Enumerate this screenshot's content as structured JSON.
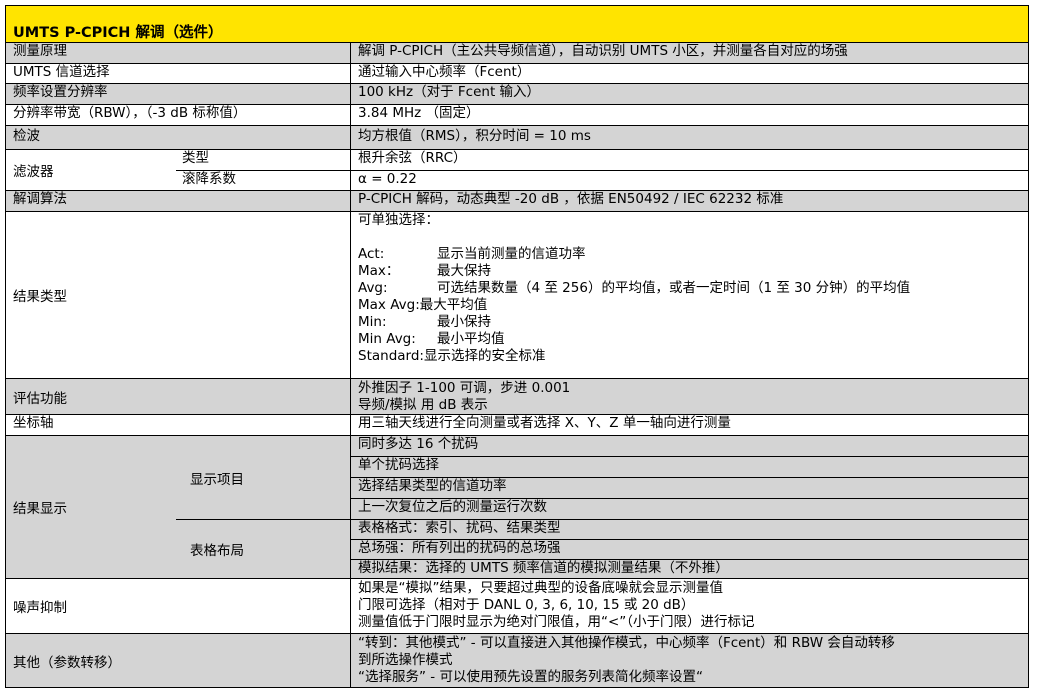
{
  "title": "UMTS P-CPICH 解调（选件）",
  "rows": [
    {
      "label": "测量原理",
      "value": "解调 P-CPICH（主公共导频信道），自动识别 UMTS 小区，并测量各自对应的场强"
    },
    {
      "label": "UMTS 信道选择",
      "value": "通过输入中心频率（Fcent）"
    },
    {
      "label": "频率设置分辨率",
      "value": "100 kHz（对于 Fcent 输入）"
    },
    {
      "label": "分辨率带宽（RBW），（-3 dB 标称值）",
      "value": "3.84 MHz （固定）"
    },
    {
      "label": "检波",
      "value": "均方根值（RMS），积分时间 = 10 ms"
    }
  ],
  "filter": {
    "label": "滤波器",
    "type_label": "类型",
    "type_value": "根升余弦（RRC）",
    "rolloff_label": "滚降系数",
    "rolloff_value": "α = 0.22"
  },
  "demod": {
    "label": "解调算法",
    "value": "P-CPICH 解码，动态典型 -20 dB ，依据 EN50492 / IEC 62232 标准"
  },
  "result_type": {
    "label": "结果类型",
    "intro": "可单独选择：",
    "items": [
      {
        "key": "Act:",
        "text": "显示当前测量的信道功率"
      },
      {
        "key": "Max：",
        "text": "最大保持"
      },
      {
        "key": "Avg:",
        "text": "可选结果数量（4 至 256）的平均值，或者一定时间（1 至 30 分钟）的平均值"
      },
      {
        "key": "Max Avg:",
        "text": "最大平均值"
      },
      {
        "key": "Min:",
        "text": "最小保持"
      },
      {
        "key": "Min Avg:",
        "text": "最小平均值"
      },
      {
        "key": "Standard:",
        "text": "显示选择的安全标准"
      }
    ]
  },
  "evaluation": {
    "label": "评估功能",
    "lines": [
      "外推因子 1-100 可调，步进 0.001",
      "导频/模拟 用 dB 表示"
    ]
  },
  "axis": {
    "label": "坐标轴",
    "value": "用三轴天线进行全向测量或者选择 X、Y、Z 单一轴向进行测量"
  },
  "result_display": {
    "label": "结果显示",
    "display_items_label": "显示项目",
    "display_items": [
      "同时多达 16 个扰码",
      "单个扰码选择",
      "选择结果类型的信道功率",
      "上一次复位之后的测量运行次数"
    ],
    "table_layout_label": "表格布局",
    "table_layout": [
      "表格格式：索引、扰码、结果类型",
      "总场强：所有列出的扰码的总场强",
      "模拟结果：选择的 UMTS 频率信道的模拟测量结果（不外推）"
    ]
  },
  "noise": {
    "label": "噪声抑制",
    "lines": [
      "如果是“模拟”结果，只要超过典型的设备底噪就会显示测量值",
      "门限可选择（相对于 DANL 0, 3, 6, 10, 15 或 20 dB）",
      "测量值低于门限时显示为绝对门限值，用“<”（小于门限）进行标记"
    ]
  },
  "other": {
    "label": "其他（参数转移）",
    "lines": [
      "“转到：其他模式” - 可以直接进入其他操作模式，中心频率（Fcent）和 RBW 会自动转移",
      "到所选操作模式",
      "“选择服务” - 可以使用预先设置的服务列表简化频率设置“"
    ]
  }
}
